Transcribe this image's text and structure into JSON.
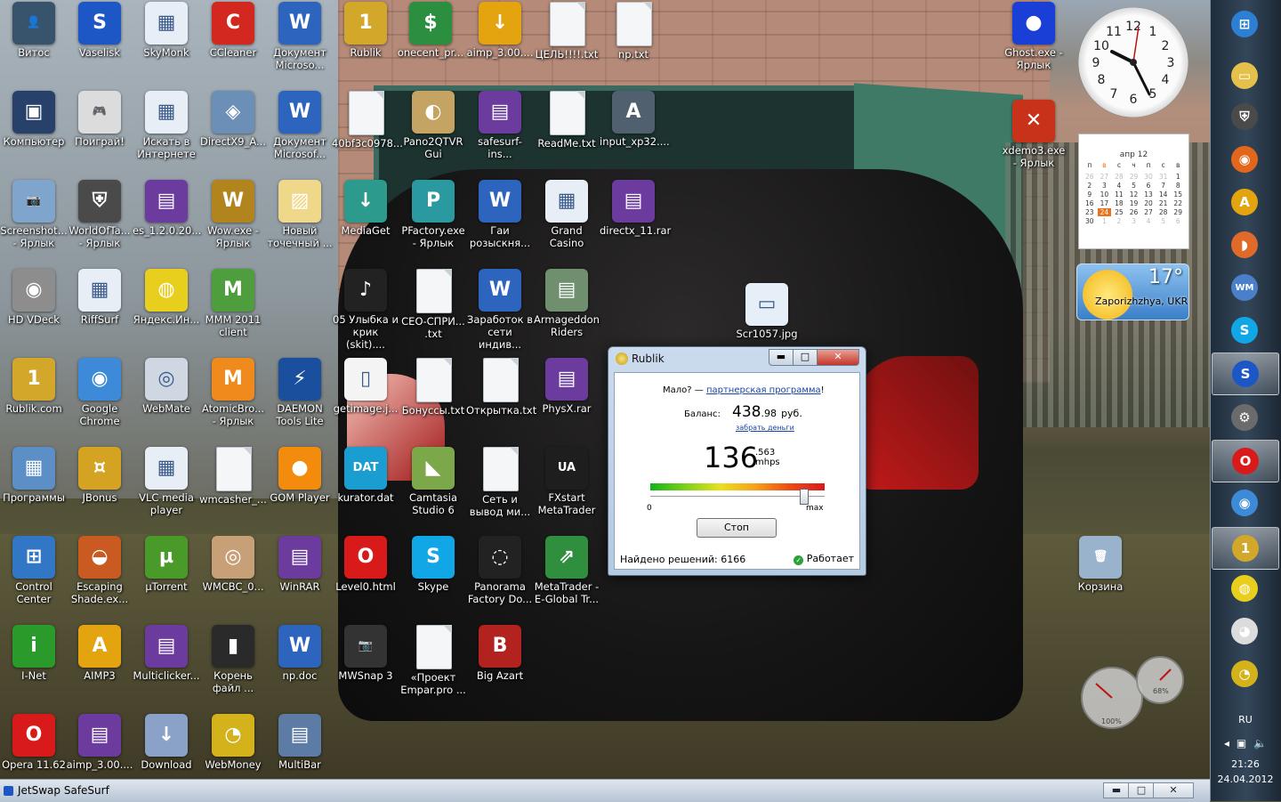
{
  "desktop_icons": [
    {
      "name": "vitos",
      "label": "Витос",
      "color": "#38546d",
      "glyph": "👤"
    },
    {
      "name": "vaselisk",
      "label": "Vaselisk",
      "color": "#1d56c5",
      "glyph": "S"
    },
    {
      "name": "skymonk",
      "label": "SkyMonk",
      "color": "#e8eef6",
      "glyph": "▦"
    },
    {
      "name": "ccleaner",
      "label": "CCleaner",
      "color": "#d2281f",
      "glyph": "C"
    },
    {
      "name": "doc-microso-1",
      "label": "Документ Microso...",
      "color": "#2c64be",
      "glyph": "W"
    },
    {
      "name": "rublik",
      "label": "Rublik",
      "color": "#d3a82a",
      "glyph": "1"
    },
    {
      "name": "onecent",
      "label": "onecent_pr...",
      "color": "#2b8f3f",
      "glyph": "$"
    },
    {
      "name": "aimp-300",
      "label": "aimp_3.00....",
      "color": "#e4a40f",
      "glyph": "↓"
    },
    {
      "name": "cel-txt",
      "label": "ЦЕЛЬ!!!!.txt",
      "color": "#f1f1f1",
      "glyph": ""
    },
    {
      "name": "np-txt",
      "label": "np.txt",
      "color": "#f1f1f1",
      "glyph": ""
    },
    {
      "name": "computer",
      "label": "Компьютер",
      "color": "#27416a",
      "glyph": "▣"
    },
    {
      "name": "poigrai",
      "label": "Поиграй!",
      "color": "#dcdcdc",
      "glyph": "🎮"
    },
    {
      "name": "iskat",
      "label": "Искать в Интернете",
      "color": "#e8eef6",
      "glyph": "▦"
    },
    {
      "name": "directx9",
      "label": "DirectX9_A...",
      "color": "#6c8fb8",
      "glyph": "◈"
    },
    {
      "name": "doc-microso-2",
      "label": "Документ Microsof...",
      "color": "#2c64be",
      "glyph": "W"
    },
    {
      "name": "40bf3c",
      "label": "40bf3c0978...",
      "color": "#f1f1f1",
      "glyph": ""
    },
    {
      "name": "pano2qtvr",
      "label": "Pano2QTVR Gui",
      "color": "#c5a463",
      "glyph": "◐"
    },
    {
      "name": "safesurf-ins",
      "label": "safesurf-ins...",
      "color": "#6b3b9e",
      "glyph": "▤"
    },
    {
      "name": "readme",
      "label": "ReadMe.txt",
      "color": "#f1f1f1",
      "glyph": ""
    },
    {
      "name": "input-xp32",
      "label": "input_xp32....",
      "color": "#51606e",
      "glyph": "A"
    },
    {
      "name": "screenshot",
      "label": "Screenshot... - Ярлык",
      "color": "#7fa5cd",
      "glyph": "📷"
    },
    {
      "name": "worldoftanks",
      "label": "WorldOfTa... - Ярлык",
      "color": "#4a4a4a",
      "glyph": "⛨"
    },
    {
      "name": "es-1-2-0",
      "label": "es_1.2.0.20...",
      "color": "#6b3b9e",
      "glyph": "▤"
    },
    {
      "name": "wow",
      "label": "Wow.exe - Ярлык",
      "color": "#b2841e",
      "glyph": "W"
    },
    {
      "name": "new-bmp",
      "label": "Новый точечный ...",
      "color": "#f0d88a",
      "glyph": "▨"
    },
    {
      "name": "mediaget",
      "label": "MediaGet",
      "color": "#2c9a8c",
      "glyph": "↓"
    },
    {
      "name": "pfactory",
      "label": "PFactory.exe - Ярлык",
      "color": "#2a9aa0",
      "glyph": "P"
    },
    {
      "name": "gai",
      "label": "Гаи розыскня...",
      "color": "#2c64be",
      "glyph": "W"
    },
    {
      "name": "grand-casino",
      "label": "Grand Casino",
      "color": "#e8eef6",
      "glyph": "▦"
    },
    {
      "name": "directx11",
      "label": "directx_11.rar",
      "color": "#6b3b9e",
      "glyph": "▤"
    },
    {
      "name": "hd-vdeck",
      "label": "HD VDeck",
      "color": "#8d8d8d",
      "glyph": "◉"
    },
    {
      "name": "riffsurf",
      "label": "RiffSurf",
      "color": "#e8eef6",
      "glyph": "▦"
    },
    {
      "name": "yandex",
      "label": "Яндекс.Ин...",
      "color": "#e8cf1d",
      "glyph": "◍"
    },
    {
      "name": "mmm2011",
      "label": "MMM 2011 client",
      "color": "#4f9e3e",
      "glyph": "M"
    },
    {
      "name": "ulybka",
      "label": "05 Улыбка и крик (skit)....",
      "color": "#222222",
      "glyph": "♪"
    },
    {
      "name": "seo-spri",
      "label": "СЕО-СПРИ... .txt",
      "color": "#f1f1f1",
      "glyph": ""
    },
    {
      "name": "zarabotok",
      "label": "Заработок в сети индив...",
      "color": "#2c64be",
      "glyph": "W"
    },
    {
      "name": "armageddon",
      "label": "Armageddon Riders",
      "color": "#6f8f6f",
      "glyph": "▤"
    },
    {
      "name": "scr1057",
      "label": "Scr1057.jpg",
      "color": "#e6eef8",
      "glyph": "▭"
    },
    {
      "name": "rublik-com",
      "label": "Rublik.com",
      "color": "#d3a82a",
      "glyph": "1"
    },
    {
      "name": "google-chrome",
      "label": "Google Chrome",
      "color": "#3d8bd8",
      "glyph": "◉"
    },
    {
      "name": "webmate",
      "label": "WebMate",
      "color": "#cfd8e2",
      "glyph": "◎"
    },
    {
      "name": "atomicbro",
      "label": "AtomicBro... - Ярлык",
      "color": "#f08a1c",
      "glyph": "M"
    },
    {
      "name": "daemon",
      "label": "DAEMON Tools Lite",
      "color": "#1a4f9e",
      "glyph": "⚡"
    },
    {
      "name": "getimage",
      "label": "getimage.j...",
      "color": "#f4f4f4",
      "glyph": "▯"
    },
    {
      "name": "bonussy",
      "label": "Бонуссы.txt",
      "color": "#f1f1f1",
      "glyph": ""
    },
    {
      "name": "otkrytka",
      "label": "Открытка.txt",
      "color": "#f1f1f1",
      "glyph": ""
    },
    {
      "name": "physx",
      "label": "PhysX.rar",
      "color": "#6b3b9e",
      "glyph": "▤"
    },
    {
      "name": "programmy",
      "label": "Программы",
      "color": "#5b8fc5",
      "glyph": "▦"
    },
    {
      "name": "jbonus",
      "label": "JBonus",
      "color": "#d4a321",
      "glyph": "¤"
    },
    {
      "name": "vlc",
      "label": "VLC media player",
      "color": "#e8eef6",
      "glyph": "▦"
    },
    {
      "name": "wmcasher",
      "label": "wmcasher_...",
      "color": "#f1f1f1",
      "glyph": ""
    },
    {
      "name": "gom-player",
      "label": "GOM Player",
      "color": "#f38c0c",
      "glyph": "●"
    },
    {
      "name": "kurator-dat",
      "label": "kurator.dat",
      "color": "#1a9ed2",
      "glyph": "DAT"
    },
    {
      "name": "camtasia",
      "label": "Camtasia Studio 6",
      "color": "#7da84a",
      "glyph": "◣"
    },
    {
      "name": "set-vyvod",
      "label": "Сеть и вывод ми...",
      "color": "#f1f1f1",
      "glyph": ""
    },
    {
      "name": "fxstart",
      "label": "FXstart MetaTrader",
      "color": "#1e1e1e",
      "glyph": "UA"
    },
    {
      "name": "control-center",
      "label": "Control Center",
      "color": "#3276c6",
      "glyph": "⊞"
    },
    {
      "name": "escaping-shade",
      "label": "Escaping Shade.ex...",
      "color": "#c85a22",
      "glyph": "◒"
    },
    {
      "name": "utorrent",
      "label": "µTorrent",
      "color": "#4a9a2a",
      "glyph": "µ"
    },
    {
      "name": "wmcbc",
      "label": "WMCBC_0...",
      "color": "#c8a078",
      "glyph": "◎"
    },
    {
      "name": "winrar",
      "label": "WinRAR",
      "color": "#6b3b9e",
      "glyph": "▤"
    },
    {
      "name": "level0",
      "label": "Level0.html",
      "color": "#d81a1a",
      "glyph": "O"
    },
    {
      "name": "skype",
      "label": "Skype",
      "color": "#11a6e5",
      "glyph": "S"
    },
    {
      "name": "panorama-factory",
      "label": "Panorama Factory Do...",
      "color": "#222222",
      "glyph": "◌"
    },
    {
      "name": "metatrader",
      "label": "MetaTrader - E-Global Tr...",
      "color": "#2f8f3f",
      "glyph": "⇗"
    },
    {
      "name": "korzina",
      "label": "Корзина",
      "color": "#9ab3cc",
      "glyph": "🗑"
    },
    {
      "name": "i-net",
      "label": "I-Net",
      "color": "#2a9b2a",
      "glyph": "i"
    },
    {
      "name": "aimp3",
      "label": "AIMP3",
      "color": "#e4a40f",
      "glyph": "A"
    },
    {
      "name": "multiclicker",
      "label": "Multiclicker...",
      "color": "#6b3b9e",
      "glyph": "▤"
    },
    {
      "name": "koren-fail",
      "label": "Корень файл ...",
      "color": "#2a2a2a",
      "glyph": "▮"
    },
    {
      "name": "np-doc",
      "label": "np.doc",
      "color": "#2c64be",
      "glyph": "W"
    },
    {
      "name": "mwsnap",
      "label": "MWSnap 3",
      "color": "#333333",
      "glyph": "📷"
    },
    {
      "name": "proekt",
      "label": "«Проект Empar.pro ...",
      "color": "#f1f1f1",
      "glyph": ""
    },
    {
      "name": "big-azart",
      "label": "Big Azart",
      "color": "#b2221e",
      "glyph": "B"
    },
    {
      "name": "opera",
      "label": "Opera 11.62",
      "color": "#d81a1a",
      "glyph": "O"
    },
    {
      "name": "aimp-300-2",
      "label": "aimp_3.00....",
      "color": "#6b3b9e",
      "glyph": "▤"
    },
    {
      "name": "download",
      "label": "Download",
      "color": "#8aa2c8",
      "glyph": "↓"
    },
    {
      "name": "webmoney",
      "label": "WebMoney",
      "color": "#d4b21c",
      "glyph": "◔"
    },
    {
      "name": "multibar",
      "label": "MultiBar",
      "color": "#5c7ca6",
      "glyph": "▤"
    },
    {
      "name": "ghost",
      "label": "Ghost.exe - Ярлык",
      "color": "#1a3fd6",
      "glyph": "●"
    },
    {
      "name": "xdemo3",
      "label": "xdemo3.exe - Ярлык",
      "color": "#c8321a",
      "glyph": "✕"
    }
  ],
  "dialog": {
    "title": "Rublik",
    "promo_text": "Мало? — ",
    "promo_link": "партнерская программа",
    "promo_end": "!",
    "balance_label": "Баланс:",
    "balance_int": "438",
    "balance_frac": ".98",
    "balance_unit": "руб.",
    "withdraw_link": "забрать деньги",
    "speed_int": "136",
    "speed_frac": ".563",
    "speed_unit": "mhps",
    "scale_min": "0",
    "scale_max": "max",
    "slider_level": 0.88,
    "stop_label": "Стоп",
    "found_label": "Найдено решений: 6166",
    "status_label": "Работает"
  },
  "gadgets": {
    "calendar_month": "апр 12",
    "weekdays": [
      "п",
      "в",
      "с",
      "ч",
      "п",
      "с",
      "в"
    ],
    "days": [
      {
        "d": "26",
        "dim": true
      },
      {
        "d": "27",
        "dim": true
      },
      {
        "d": "28",
        "dim": true
      },
      {
        "d": "29",
        "dim": true
      },
      {
        "d": "30",
        "dim": true
      },
      {
        "d": "31",
        "dim": true
      },
      {
        "d": "1"
      },
      {
        "d": "2"
      },
      {
        "d": "3"
      },
      {
        "d": "4"
      },
      {
        "d": "5"
      },
      {
        "d": "6"
      },
      {
        "d": "7"
      },
      {
        "d": "8"
      },
      {
        "d": "9"
      },
      {
        "d": "10"
      },
      {
        "d": "11"
      },
      {
        "d": "12"
      },
      {
        "d": "13"
      },
      {
        "d": "14"
      },
      {
        "d": "15"
      },
      {
        "d": "16"
      },
      {
        "d": "17"
      },
      {
        "d": "18"
      },
      {
        "d": "19"
      },
      {
        "d": "20"
      },
      {
        "d": "21"
      },
      {
        "d": "22"
      },
      {
        "d": "23"
      },
      {
        "d": "24",
        "today": true
      },
      {
        "d": "25"
      },
      {
        "d": "26"
      },
      {
        "d": "27"
      },
      {
        "d": "28"
      },
      {
        "d": "29"
      },
      {
        "d": "30"
      },
      {
        "d": "1",
        "dim": true
      },
      {
        "d": "2",
        "dim": true
      },
      {
        "d": "3",
        "dim": true
      },
      {
        "d": "4",
        "dim": true
      },
      {
        "d": "5",
        "dim": true
      },
      {
        "d": "6",
        "dim": true
      }
    ],
    "weather_temp": "17°",
    "weather_city": "Zaporizhzhya, UKR",
    "cpu_percent": "100%",
    "mem_percent": "68%"
  },
  "sidebar": {
    "apps": [
      {
        "name": "start-orb",
        "color": "#2d7fd3",
        "glyph": "⊞"
      },
      {
        "name": "explorer",
        "color": "#e5c04a",
        "glyph": "▭"
      },
      {
        "name": "worldoftanks",
        "color": "#4a4a4a",
        "glyph": "⛨"
      },
      {
        "name": "firefox",
        "color": "#e2661b",
        "glyph": "◉"
      },
      {
        "name": "aimp",
        "color": "#e4a40f",
        "glyph": "A"
      },
      {
        "name": "fish",
        "color": "#e06a2a",
        "glyph": "◗"
      },
      {
        "name": "webmoney-keeper",
        "color": "#4a7fc9",
        "glyph": "WM"
      },
      {
        "name": "skype",
        "color": "#11a6e5",
        "glyph": "S"
      },
      {
        "name": "safesurf",
        "color": "#1d56c5",
        "glyph": "S",
        "active": true
      },
      {
        "name": "settings",
        "color": "#6b6b6b",
        "glyph": "⚙"
      },
      {
        "name": "opera",
        "color": "#d81a1a",
        "glyph": "O",
        "active": true
      },
      {
        "name": "chrome",
        "color": "#3d8bd8",
        "glyph": "◉"
      },
      {
        "name": "rublik",
        "color": "#d3a82a",
        "glyph": "1",
        "active": true
      },
      {
        "name": "yandex-bar",
        "color": "#e8cf1d",
        "glyph": "◍"
      },
      {
        "name": "eyes",
        "color": "#dcdcdc",
        "glyph": "◕"
      },
      {
        "name": "webmoney",
        "color": "#d4b21c",
        "glyph": "◔"
      }
    ],
    "language": "RU",
    "time": "21:26",
    "date": "24.04.2012"
  },
  "bottombar": {
    "title": "JetSwap SafeSurf",
    "minimize": "▬",
    "maximize": "□",
    "close": "✕"
  }
}
